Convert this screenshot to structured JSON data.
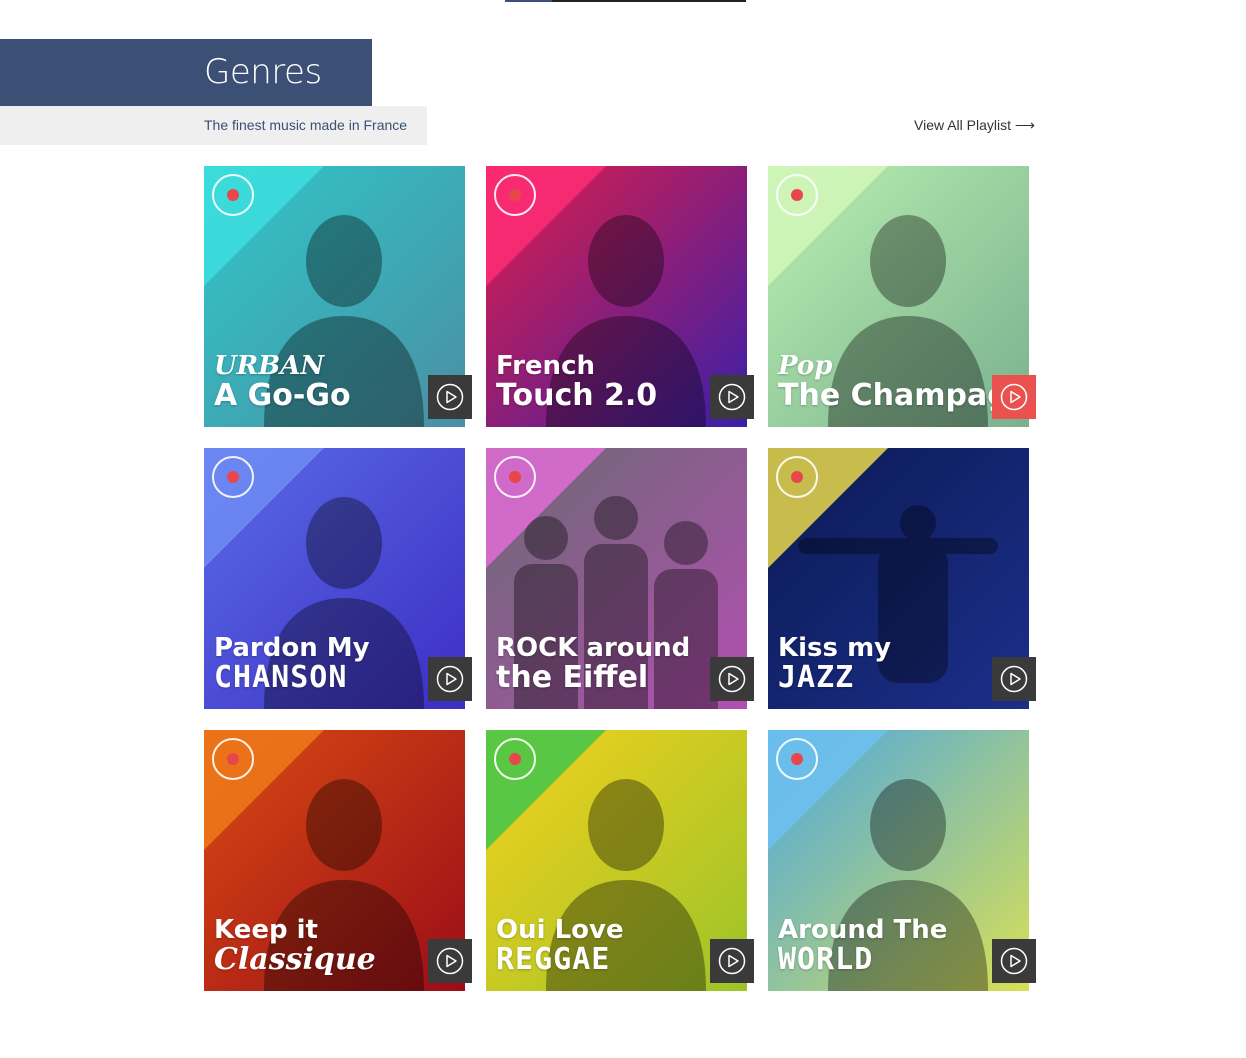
{
  "header": {
    "title": "Genres",
    "subtitle": "The finest music made in France",
    "view_all_label": "View All Playlist ⟶"
  },
  "colors": {
    "accent": "#3b5074",
    "subtitle_bg": "#efefef",
    "play_button": "#3a3a3a",
    "play_button_active": "#e9524f"
  },
  "playlists": [
    {
      "line1": "URBAN",
      "line2": "A Go-Go",
      "bg_from": "#2fc7c9",
      "bg_to": "#4a8fa3",
      "corner": "#3ddede",
      "icon": "person-silhouette-icon",
      "active": false
    },
    {
      "line1": "French",
      "line2": "Touch 2.0",
      "bg_from": "#e01e48",
      "bg_to": "#3a1fa8",
      "corner": "#ff2d77",
      "icon": "person-silhouette-icon",
      "active": false
    },
    {
      "line1": "Pop",
      "line2": "The Champag",
      "bg_from": "#b9efb0",
      "bg_to": "#7ab08f",
      "corner": "#d2f7b8",
      "icon": "person-silhouette-icon",
      "active": true
    },
    {
      "line1": "Pardon My",
      "line2": "CHANSON",
      "bg_from": "#5a6be6",
      "bg_to": "#3c2ec4",
      "corner": "#6e8cf2",
      "icon": "person-silhouette-icon",
      "active": false
    },
    {
      "line1": "ROCK around",
      "line2": "the Eiffel",
      "bg_from": "#6a6a73",
      "bg_to": "#b24fb0",
      "corner": "#e06bd6",
      "icon": "band-silhouette-icon",
      "active": false
    },
    {
      "line1": "Kiss my",
      "line2": "JAZZ",
      "bg_from": "#0c1a55",
      "bg_to": "#1b2f8a",
      "corner": "#e8d84a",
      "icon": "trumpet-player-icon",
      "active": false
    },
    {
      "line1": "Keep it",
      "line2": "Classique",
      "bg_from": "#d94a12",
      "bg_to": "#9a0d18",
      "corner": "#f07a1a",
      "icon": "person-silhouette-icon",
      "active": false
    },
    {
      "line1": "Oui Love",
      "line2": "REGGAE",
      "bg_from": "#f4d11c",
      "bg_to": "#9cc32a",
      "corner": "#3fc64a",
      "icon": "person-silhouette-icon",
      "active": false
    },
    {
      "line1": "Around The",
      "line2": "WORLD",
      "bg_from": "#4aa7e4",
      "bg_to": "#d8df55",
      "corner": "#6fc1ee",
      "icon": "person-silhouette-icon",
      "active": false
    }
  ]
}
